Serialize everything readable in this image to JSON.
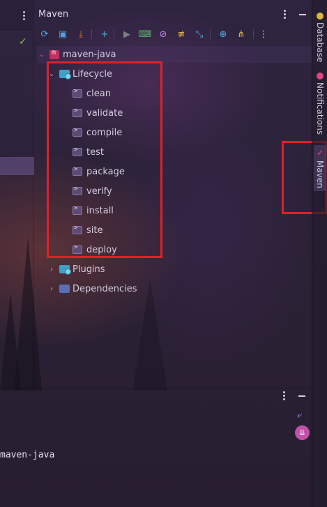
{
  "window": {
    "title": "Maven"
  },
  "toolbar": {
    "items": [
      {
        "name": "reload-icon",
        "glyph": "⟳",
        "color": "#4fb3e8"
      },
      {
        "name": "generate-sources-icon",
        "glyph": "▣",
        "color": "#4fa3e0"
      },
      {
        "name": "download-icon",
        "glyph": "⤓",
        "color": "#e07a3c"
      },
      {
        "name": "add-icon",
        "glyph": "+",
        "color": "#4fb3e8"
      },
      {
        "name": "run-icon",
        "glyph": "▶",
        "color": "#7d7b86"
      },
      {
        "name": "execute-goal-icon",
        "glyph": "⌨",
        "color": "#57b36a"
      },
      {
        "name": "toggle-offline-icon",
        "glyph": "⊘",
        "color": "#c88ae8"
      },
      {
        "name": "skip-tests-icon",
        "glyph": "≢",
        "color": "#e0b23c"
      },
      {
        "name": "collapse-all-icon",
        "glyph": "⤡",
        "color": "#4fb3e8"
      },
      {
        "name": "analyze-icon",
        "glyph": "⊕",
        "color": "#4fb3e8"
      },
      {
        "name": "diagram-icon",
        "glyph": "⋔",
        "color": "#e0b23c"
      }
    ]
  },
  "tree": {
    "root": {
      "label": "maven-java"
    },
    "lifecycle": {
      "label": "Lifecycle",
      "goals": [
        "clean",
        "validate",
        "compile",
        "test",
        "package",
        "verify",
        "install",
        "site",
        "deploy"
      ]
    },
    "plugins": {
      "label": "Plugins"
    },
    "dependencies": {
      "label": "Dependencies"
    }
  },
  "right_stripe": {
    "tabs": [
      {
        "label": "Database",
        "color": "#e0b23c"
      },
      {
        "label": "Notifications",
        "color": "#e0457b"
      },
      {
        "label": "Maven",
        "color": "#e0457b"
      }
    ]
  },
  "console": {
    "line": "maven-java"
  },
  "colors": {
    "annotation": "#e0202a",
    "accent": "#e0457b"
  }
}
